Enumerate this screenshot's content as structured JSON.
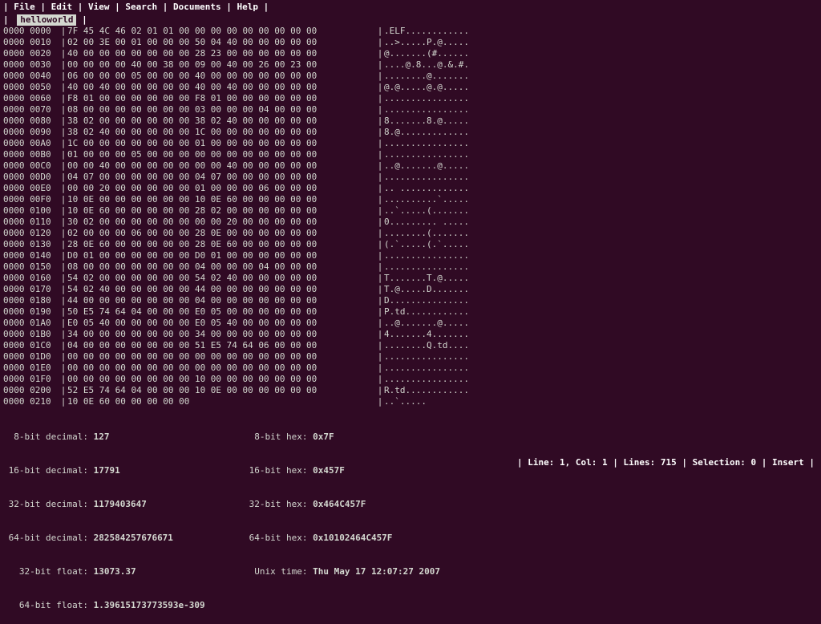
{
  "menu": {
    "file": "File",
    "edit": "Edit",
    "view": "View",
    "search": "Search",
    "documents": "Documents",
    "help": "Help"
  },
  "tab": {
    "filename": "helloworld"
  },
  "hex_rows": [
    {
      "offset": "0000 0000",
      "bytes": "7F 45 4C 46 02 01 01 00 00 00 00 00 00 00 00 00",
      "ascii": ".ELF............"
    },
    {
      "offset": "0000 0010",
      "bytes": "02 00 3E 00 01 00 00 00 50 04 40 00 00 00 00 00",
      "ascii": "..>.....P.@....."
    },
    {
      "offset": "0000 0020",
      "bytes": "40 00 00 00 00 00 00 00 28 23 00 00 00 00 00 00",
      "ascii": "@.......(#......"
    },
    {
      "offset": "0000 0030",
      "bytes": "00 00 00 00 40 00 38 00 09 00 40 00 26 00 23 00",
      "ascii": "....@.8...@.&.#."
    },
    {
      "offset": "0000 0040",
      "bytes": "06 00 00 00 05 00 00 00 40 00 00 00 00 00 00 00",
      "ascii": "........@......."
    },
    {
      "offset": "0000 0050",
      "bytes": "40 00 40 00 00 00 00 00 40 00 40 00 00 00 00 00",
      "ascii": "@.@.....@.@....."
    },
    {
      "offset": "0000 0060",
      "bytes": "F8 01 00 00 00 00 00 00 F8 01 00 00 00 00 00 00",
      "ascii": "................"
    },
    {
      "offset": "0000 0070",
      "bytes": "08 00 00 00 00 00 00 00 03 00 00 00 04 00 00 00",
      "ascii": "................"
    },
    {
      "offset": "0000 0080",
      "bytes": "38 02 00 00 00 00 00 00 38 02 40 00 00 00 00 00",
      "ascii": "8.......8.@....."
    },
    {
      "offset": "0000 0090",
      "bytes": "38 02 40 00 00 00 00 00 1C 00 00 00 00 00 00 00",
      "ascii": "8.@............."
    },
    {
      "offset": "0000 00A0",
      "bytes": "1C 00 00 00 00 00 00 00 01 00 00 00 00 00 00 00",
      "ascii": "................"
    },
    {
      "offset": "0000 00B0",
      "bytes": "01 00 00 00 05 00 00 00 00 00 00 00 00 00 00 00",
      "ascii": "................"
    },
    {
      "offset": "0000 00C0",
      "bytes": "00 00 40 00 00 00 00 00 00 00 40 00 00 00 00 00",
      "ascii": "..@.......@....."
    },
    {
      "offset": "0000 00D0",
      "bytes": "04 07 00 00 00 00 00 00 04 07 00 00 00 00 00 00",
      "ascii": "................"
    },
    {
      "offset": "0000 00E0",
      "bytes": "00 00 20 00 00 00 00 00 01 00 00 00 06 00 00 00",
      "ascii": ".. ............."
    },
    {
      "offset": "0000 00F0",
      "bytes": "10 0E 00 00 00 00 00 00 10 0E 60 00 00 00 00 00",
      "ascii": "..........`....."
    },
    {
      "offset": "0000 0100",
      "bytes": "10 0E 60 00 00 00 00 00 28 02 00 00 00 00 00 00",
      "ascii": "..`.....(......."
    },
    {
      "offset": "0000 0110",
      "bytes": "30 02 00 00 00 00 00 00 00 00 20 00 00 00 00 00",
      "ascii": "0......... ....."
    },
    {
      "offset": "0000 0120",
      "bytes": "02 00 00 00 06 00 00 00 28 0E 00 00 00 00 00 00",
      "ascii": "........(......."
    },
    {
      "offset": "0000 0130",
      "bytes": "28 0E 60 00 00 00 00 00 28 0E 60 00 00 00 00 00",
      "ascii": "(.`.....(.`....."
    },
    {
      "offset": "0000 0140",
      "bytes": "D0 01 00 00 00 00 00 00 D0 01 00 00 00 00 00 00",
      "ascii": "................"
    },
    {
      "offset": "0000 0150",
      "bytes": "08 00 00 00 00 00 00 00 04 00 00 00 04 00 00 00",
      "ascii": "................"
    },
    {
      "offset": "0000 0160",
      "bytes": "54 02 00 00 00 00 00 00 54 02 40 00 00 00 00 00",
      "ascii": "T.......T.@....."
    },
    {
      "offset": "0000 0170",
      "bytes": "54 02 40 00 00 00 00 00 44 00 00 00 00 00 00 00",
      "ascii": "T.@.....D......."
    },
    {
      "offset": "0000 0180",
      "bytes": "44 00 00 00 00 00 00 00 04 00 00 00 00 00 00 00",
      "ascii": "D..............."
    },
    {
      "offset": "0000 0190",
      "bytes": "50 E5 74 64 04 00 00 00 E0 05 00 00 00 00 00 00",
      "ascii": "P.td............"
    },
    {
      "offset": "0000 01A0",
      "bytes": "E0 05 40 00 00 00 00 00 E0 05 40 00 00 00 00 00",
      "ascii": "..@.......@....."
    },
    {
      "offset": "0000 01B0",
      "bytes": "34 00 00 00 00 00 00 00 34 00 00 00 00 00 00 00",
      "ascii": "4.......4......."
    },
    {
      "offset": "0000 01C0",
      "bytes": "04 00 00 00 00 00 00 00 51 E5 74 64 06 00 00 00",
      "ascii": "........Q.td...."
    },
    {
      "offset": "0000 01D0",
      "bytes": "00 00 00 00 00 00 00 00 00 00 00 00 00 00 00 00",
      "ascii": "................"
    },
    {
      "offset": "0000 01E0",
      "bytes": "00 00 00 00 00 00 00 00 00 00 00 00 00 00 00 00",
      "ascii": "................"
    },
    {
      "offset": "0000 01F0",
      "bytes": "00 00 00 00 00 00 00 00 10 00 00 00 00 00 00 00",
      "ascii": "................"
    },
    {
      "offset": "0000 0200",
      "bytes": "52 E5 74 64 04 00 00 00 10 0E 00 00 00 00 00 00",
      "ascii": "R.td............"
    },
    {
      "offset": "0000 0210",
      "bytes": "10 0E 60 00 00 00 00 00",
      "ascii": "..`....."
    }
  ],
  "info": {
    "dec8_label": "  8-bit decimal: ",
    "dec8": "127",
    "dec16_label": " 16-bit decimal: ",
    "dec16": "17791",
    "dec32_label": " 32-bit decimal: ",
    "dec32": "1179403647",
    "dec64_label": " 64-bit decimal: ",
    "dec64": "282584257676671",
    "f32_label": "   32-bit float: ",
    "f32": "13073.37",
    "f64_label": "   64-bit float: ",
    "f64": "1.39615173773593e-309",
    "hex8_label": "  8-bit hex: ",
    "hex8": "0x7F",
    "hex16_label": " 16-bit hex: ",
    "hex16": "0x457F",
    "hex32_label": " 32-bit hex: ",
    "hex32": "0x464C457F",
    "hex64_label": " 64-bit hex: ",
    "hex64": "0x10102464C457F",
    "unix_label": "  Unix time: ",
    "unix": "Thu May 17 12:07:27 2007"
  },
  "status": {
    "line_label": "Line: ",
    "line": "1",
    "col_label": "Col: ",
    "col": "1",
    "lines_label": "Lines: ",
    "lines": "715",
    "sel_label": "Selection: ",
    "sel": "0",
    "mode": "Insert"
  }
}
